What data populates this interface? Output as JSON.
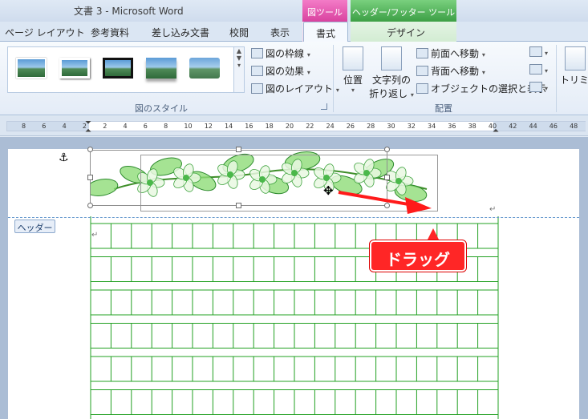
{
  "window": {
    "title": "文書 3 - Microsoft Word"
  },
  "context_tabs": {
    "picture_tools": "図ツール",
    "header_footer_tools": "ヘッダー/フッター ツール"
  },
  "tabs": [
    {
      "label": "ページ レイアウト"
    },
    {
      "label": "参考資料"
    },
    {
      "label": "差し込み文書"
    },
    {
      "label": "校閲"
    },
    {
      "label": "表示"
    },
    {
      "label": "書式"
    },
    {
      "label": "デザイン"
    }
  ],
  "ribbon": {
    "picture_styles": {
      "group_label": "図のスタイル",
      "border": "図の枠線",
      "effects": "図の効果",
      "layout": "図のレイアウト"
    },
    "arrange": {
      "group_label": "配置",
      "position": "位置",
      "wrap_line1": "文字列の",
      "wrap_line2": "折り返し",
      "bring_forward": "前面へ移動",
      "send_backward": "背面へ移動",
      "selection_pane": "オブジェクトの選択と表示"
    },
    "crop": "トリミング"
  },
  "ruler_ticks": [
    "8",
    "6",
    "4",
    "2",
    "2",
    "4",
    "6",
    "8",
    "10",
    "12",
    "14",
    "16",
    "18",
    "20",
    "22",
    "24",
    "26",
    "28",
    "30",
    "32",
    "34",
    "36",
    "38",
    "40",
    "42",
    "44",
    "46",
    "48"
  ],
  "document": {
    "header_tag": "ヘッダー",
    "callout": "ドラッグ",
    "grid_rows": 6,
    "grid_cols": 20
  },
  "colors": {
    "grid_line": "#22a022",
    "callout": "#ff2626",
    "header_divider": "#6a9ccf"
  }
}
